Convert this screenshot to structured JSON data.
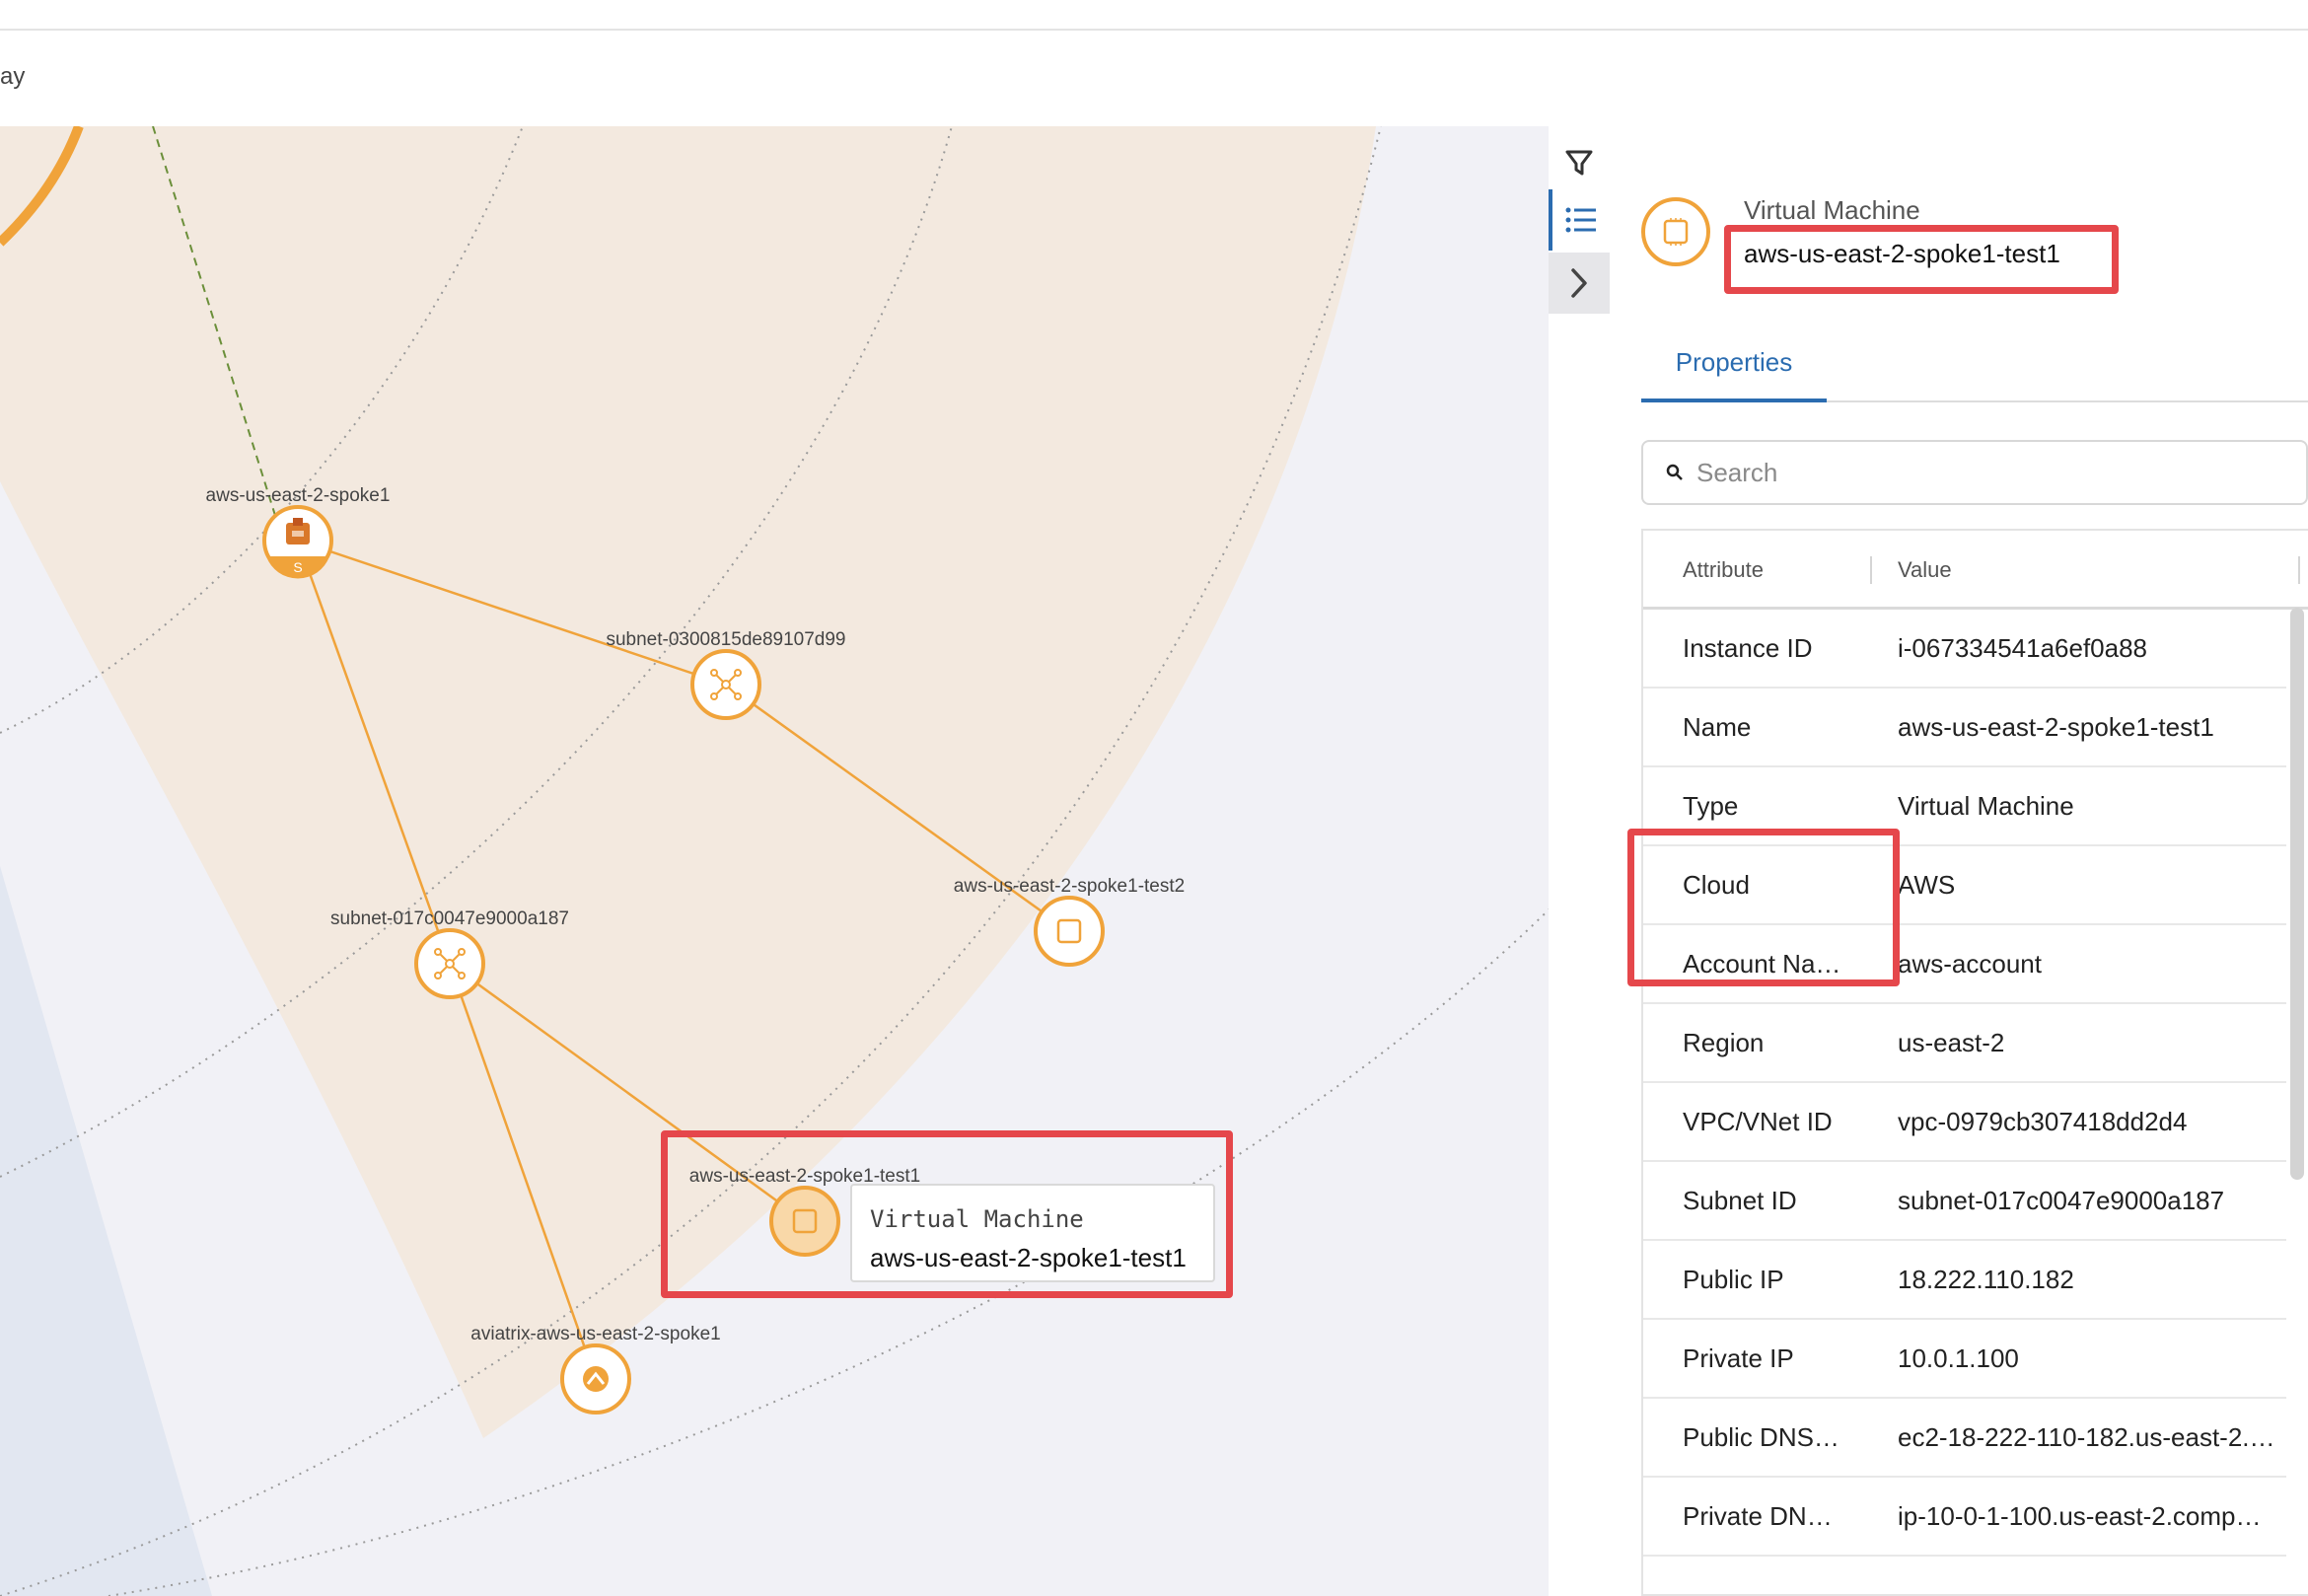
{
  "header": {
    "breadcrumb_fragment": "ay"
  },
  "toolbar": {
    "filter_icon": "filter-icon",
    "list_icon": "list-icon",
    "collapse_icon": "chevron-right-icon"
  },
  "topology": {
    "nodes": [
      {
        "id": "gw",
        "label": "aws-us-east-2-spoke1",
        "kind": "gateway",
        "badge": "S",
        "icon": "aws-gateway-icon"
      },
      {
        "id": "sn1",
        "label": "subnet-0300815de89107d99",
        "kind": "subnet",
        "icon": "subnet-icon"
      },
      {
        "id": "sn2",
        "label": "subnet-017c0047e9000a187",
        "kind": "subnet",
        "icon": "subnet-icon"
      },
      {
        "id": "vm2",
        "label": "aws-us-east-2-spoke1-test2",
        "kind": "vm",
        "icon": "chip-icon"
      },
      {
        "id": "vm1",
        "label": "aws-us-east-2-spoke1-test1",
        "kind": "vm",
        "selected": true,
        "icon": "chip-icon"
      },
      {
        "id": "av",
        "label": "aviatrix-aws-us-east-2-spoke1",
        "kind": "aviatrix",
        "icon": "aviatrix-icon"
      }
    ],
    "edges": [
      [
        "gw",
        "sn1"
      ],
      [
        "gw",
        "sn2"
      ],
      [
        "sn1",
        "vm2"
      ],
      [
        "sn2",
        "vm1"
      ],
      [
        "sn2",
        "av"
      ]
    ],
    "tooltip": {
      "type": "Virtual Machine",
      "name": "aws-us-east-2-spoke1-test1"
    }
  },
  "panel": {
    "type": "Virtual Machine",
    "name": "aws-us-east-2-spoke1-test1",
    "tab": "Properties",
    "search_placeholder": "Search",
    "columns": {
      "attribute": "Attribute",
      "value": "Value"
    },
    "rows": [
      {
        "attribute": "Instance ID",
        "value": "i-067334541a6ef0a88"
      },
      {
        "attribute": "Name",
        "value": "aws-us-east-2-spoke1-test1"
      },
      {
        "attribute": "Type",
        "value": "Virtual Machine"
      },
      {
        "attribute": "Cloud",
        "value": "AWS"
      },
      {
        "attribute": "Account Na…",
        "value": "aws-account"
      },
      {
        "attribute": "Region",
        "value": "us-east-2"
      },
      {
        "attribute": "VPC/VNet ID",
        "value": "vpc-0979cb307418dd2d4"
      },
      {
        "attribute": "Subnet ID",
        "value": "subnet-017c0047e9000a187"
      },
      {
        "attribute": "Public IP",
        "value": "18.222.110.182"
      },
      {
        "attribute": "Private IP",
        "value": "10.0.1.100"
      },
      {
        "attribute": "Public DNS…",
        "value": "ec2-18-222-110-182.us-east-2.…"
      },
      {
        "attribute": "Private DN…",
        "value": "ip-10-0-1-100.us-east-2.comp…"
      }
    ]
  },
  "colors": {
    "accent_orange": "#f0a33a",
    "link_blue": "#2b6cb0",
    "highlight_red": "#e5474b",
    "zone_fill": "#f3e9df",
    "canvas_bg": "#f1f1f6"
  }
}
